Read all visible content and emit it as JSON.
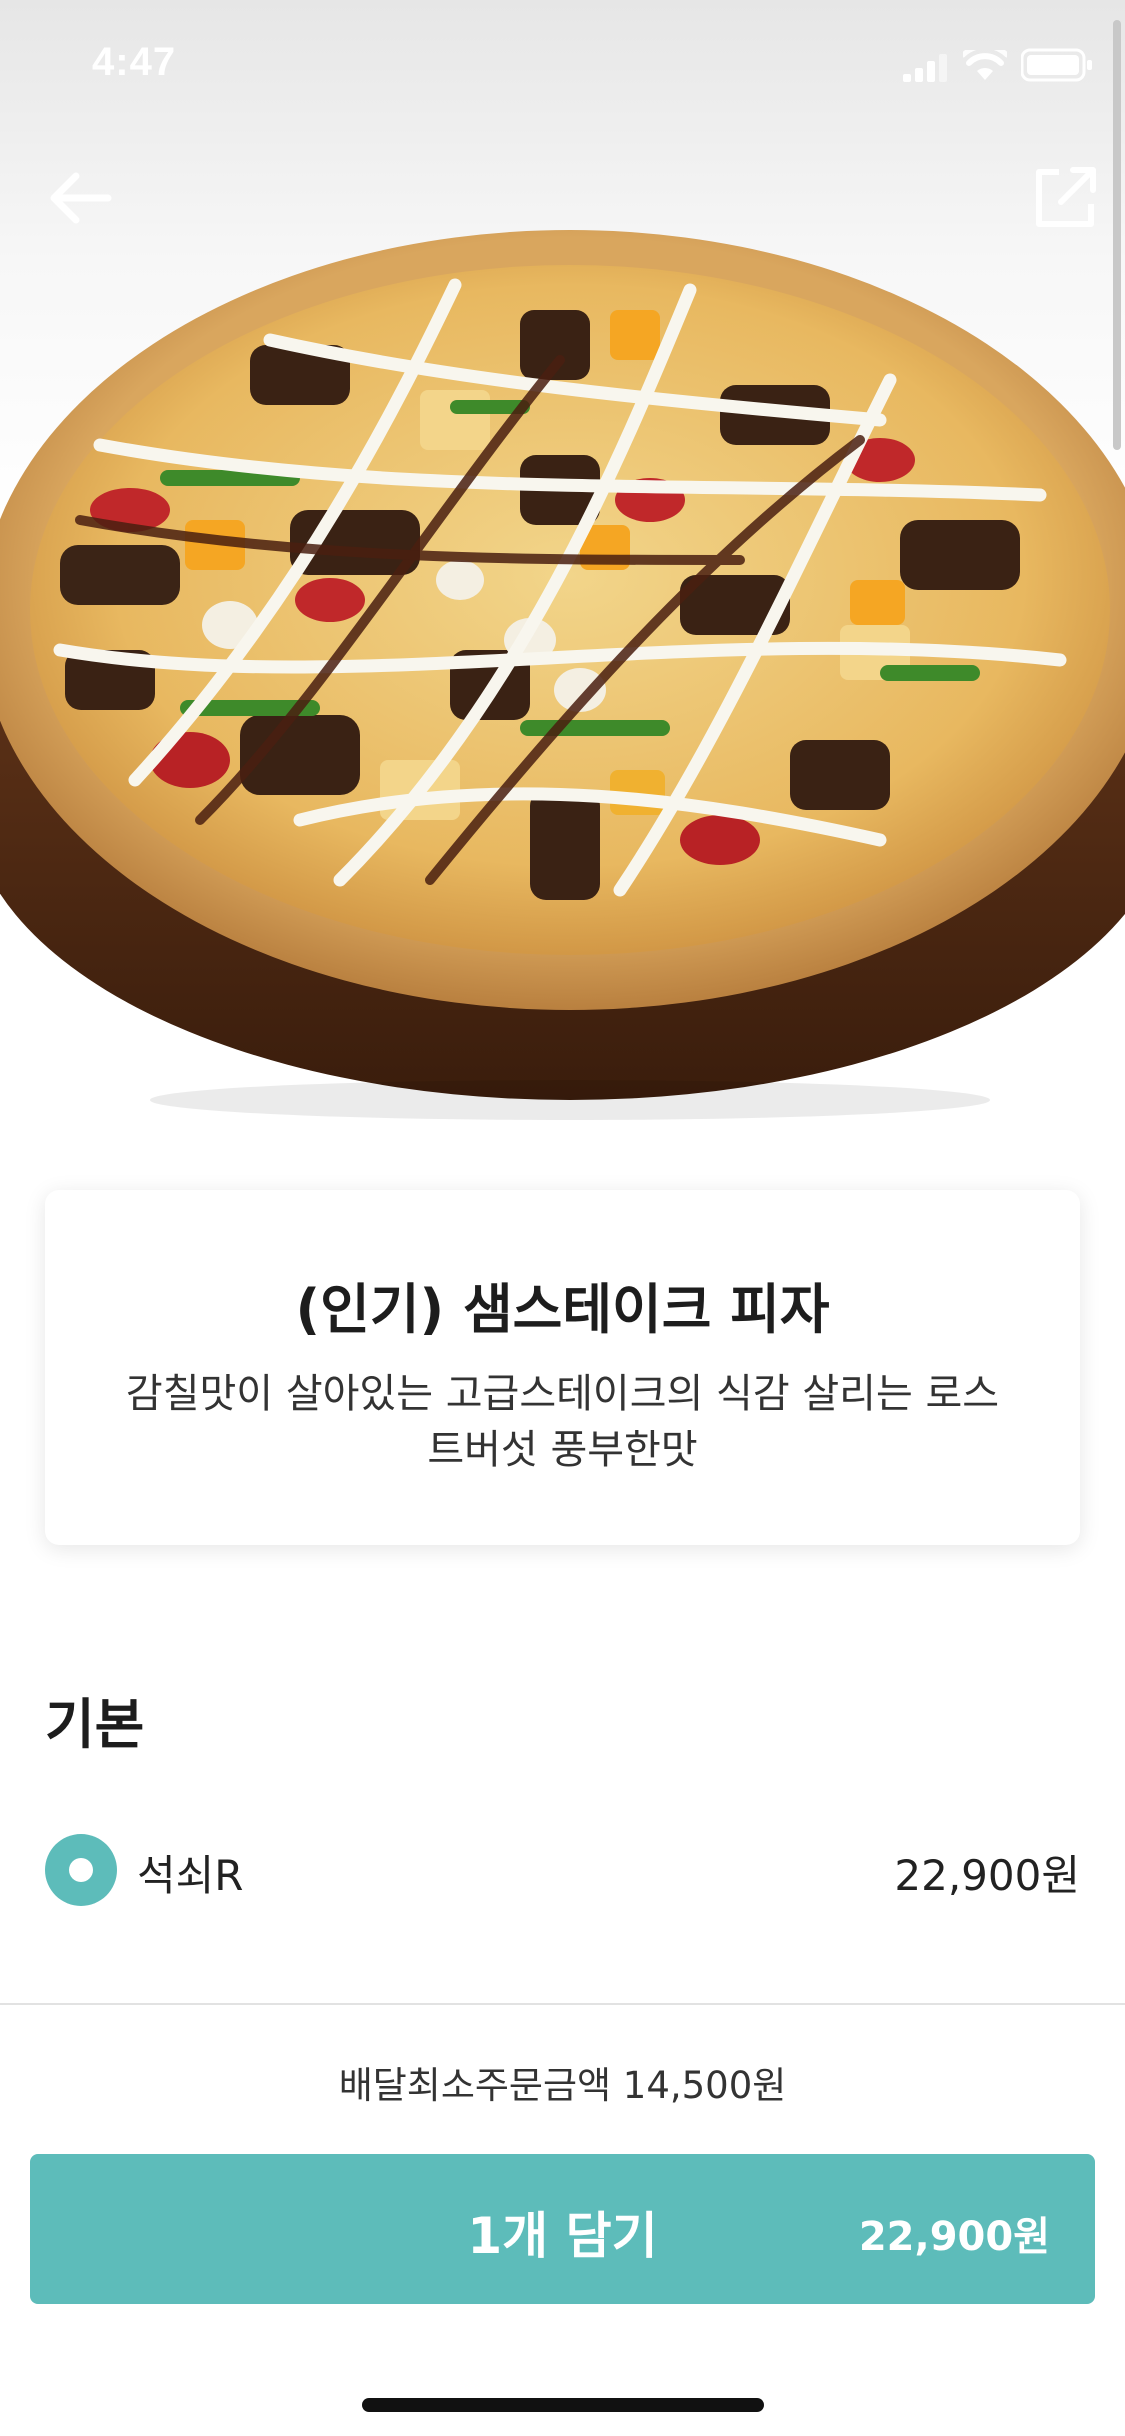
{
  "status_bar": {
    "time": "4:47"
  },
  "navigation": {
    "back_icon": "arrow-left-icon",
    "share_icon": "share-icon"
  },
  "hero": {
    "image": "pizza-photo"
  },
  "product": {
    "name": "(인기) 샘스테이크 피자",
    "description": "감칠맛이 살아있는 고급스테이크의 식감 살리는 로스트버섯 풍부한맛"
  },
  "options": {
    "section_title": "기본",
    "items": [
      {
        "label": "석쇠R",
        "price": "22,900원",
        "selected": true
      }
    ]
  },
  "footer": {
    "min_order": "배달최소주문금액 14,500원",
    "add_button_label": "1개 담기",
    "add_button_price": "22,900원"
  },
  "colors": {
    "accent": "#5dbcba"
  }
}
